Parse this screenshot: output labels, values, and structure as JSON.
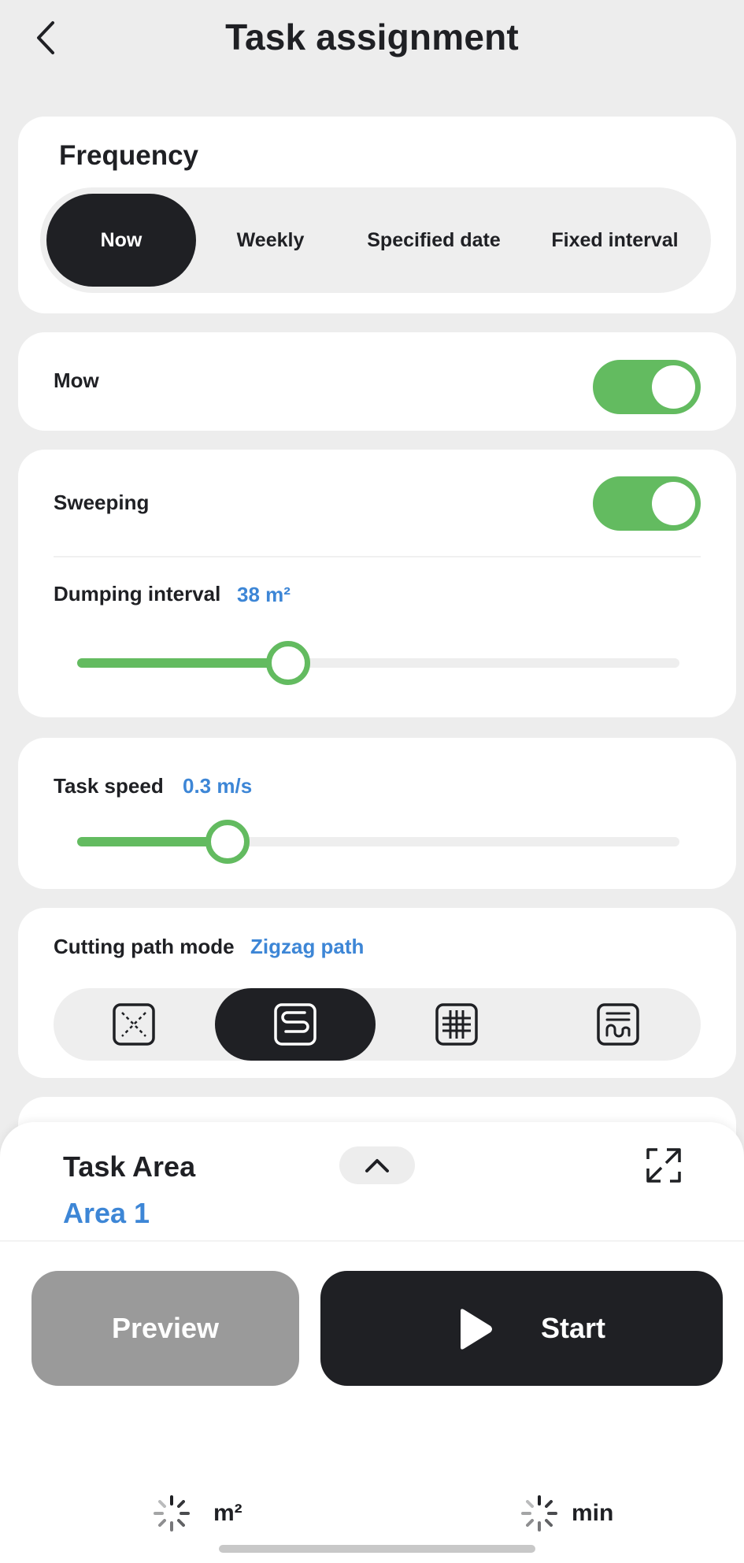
{
  "header": {
    "title": "Task assignment",
    "back_icon": "chevron-left-icon"
  },
  "frequency": {
    "title": "Frequency",
    "options": [
      "Now",
      "Weekly",
      "Specified date",
      "Fixed interval"
    ],
    "selected": "Now"
  },
  "mow": {
    "label": "Mow",
    "enabled": true
  },
  "sweeping": {
    "label": "Sweeping",
    "enabled": true,
    "dumping_interval": {
      "label": "Dumping interval",
      "value_text": "38 m²",
      "fraction": 0.35
    }
  },
  "task_speed": {
    "label": "Task speed",
    "value_text": "0.3 m/s",
    "fraction": 0.25
  },
  "cutting_path": {
    "label": "Cutting path mode",
    "value_text": "Zigzag path",
    "options": [
      "random-path-icon",
      "zigzag-path-icon",
      "grid-path-icon",
      "spiral-path-icon"
    ],
    "selected_index": 1
  },
  "task_area": {
    "title": "Task Area",
    "area_name": "Area 1",
    "collapse_icon": "chevron-up-icon",
    "expand_icon": "expand-icon"
  },
  "actions": {
    "preview_label": "Preview",
    "start_label": "Start",
    "start_icon": "play-icon"
  },
  "stats": {
    "area_unit": "m²",
    "time_unit": "min"
  },
  "colors": {
    "accent_green": "#63bb60",
    "accent_blue": "#3d86d6",
    "dark": "#1f2024",
    "background": "#ededed",
    "disabled": "#9a9a9a"
  }
}
